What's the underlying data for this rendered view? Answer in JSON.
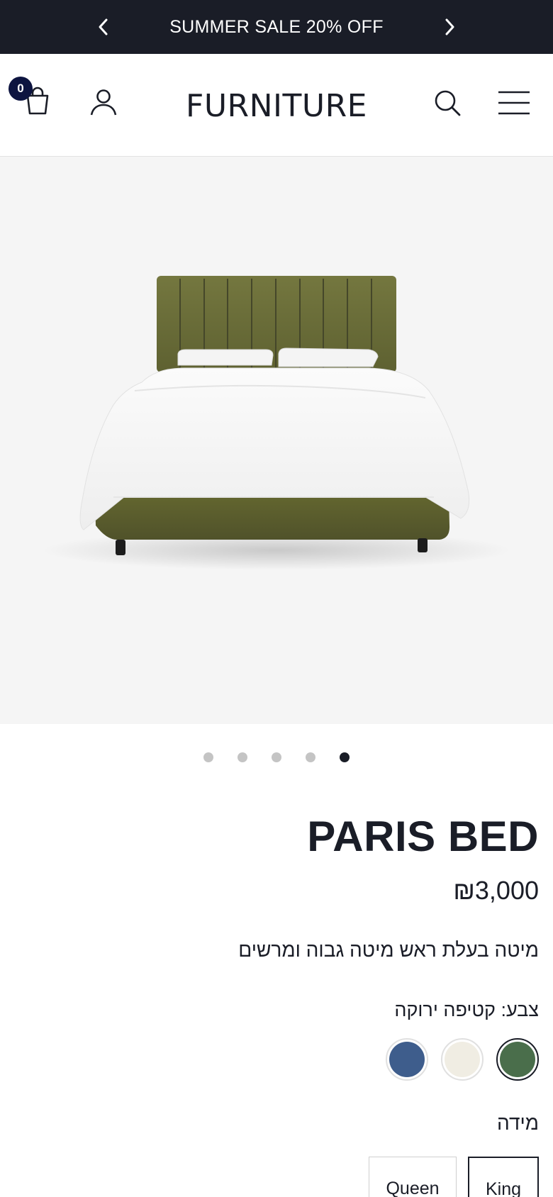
{
  "announcement": {
    "text": "SUMMER SALE 20% OFF",
    "prev_icon": "chevron-left-icon",
    "next_icon": "chevron-right-icon"
  },
  "header": {
    "logo": "FURNITURE",
    "cart_count": "0",
    "icons": [
      "shopping-bag-icon",
      "user-icon",
      "search-icon",
      "hamburger-menu-icon"
    ]
  },
  "gallery": {
    "image": "green-upholstered-bed-image",
    "slide_count": 5,
    "active_slide": 5
  },
  "product": {
    "title": "PARIS BED",
    "price": "₪3,000",
    "description": "מיטה בעלת ראש מיטה גבוה ומרשים",
    "color_label": "צבע: קטיפה ירוקה",
    "colors": [
      {
        "name": "green",
        "hex": "#4a6e4b",
        "selected": true
      },
      {
        "name": "cream",
        "hex": "#f0ede3",
        "selected": false
      },
      {
        "name": "blue",
        "hex": "#3e5d8c",
        "selected": false
      }
    ],
    "size_label": "מידה",
    "sizes": [
      {
        "label": "King",
        "selected": true
      },
      {
        "label": "Queen",
        "selected": false
      }
    ]
  },
  "theme": {
    "dark": "#1a1d27",
    "badge": "#0d1440",
    "gallery_bg": "#f5f5f5",
    "bed_green": "#6b6e3a"
  }
}
